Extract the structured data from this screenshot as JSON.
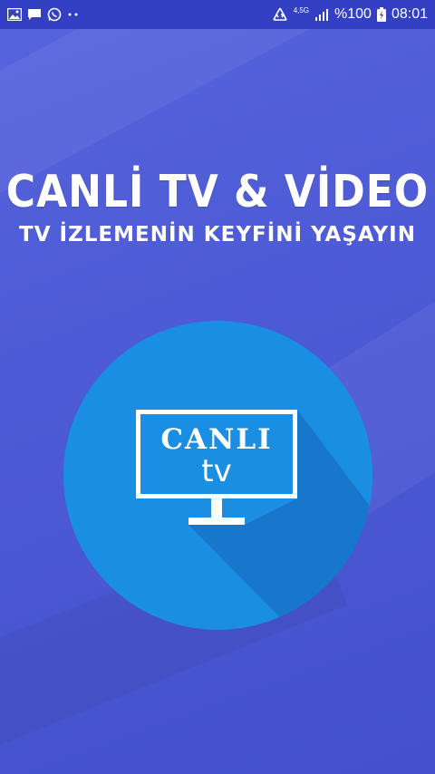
{
  "status_bar": {
    "left_icons": [
      "image-icon",
      "message-icon",
      "whatsapp-icon",
      "more-dots-icon"
    ],
    "network_label": "4,5G",
    "battery_percent": "%100",
    "time": "08:01"
  },
  "splash": {
    "title": "CANLİ TV & VİDEO",
    "subtitle": "TV İZLEMENİN KEYFİNİ YAŞAYIN",
    "logo_line1": "CANLI",
    "logo_line2": "tv"
  },
  "colors": {
    "background": "#4d5ad5",
    "status_bar": "#3340c4",
    "logo_circle": "#1a8ee3",
    "logo_shadow": "#1565b6",
    "text": "#ffffff"
  }
}
